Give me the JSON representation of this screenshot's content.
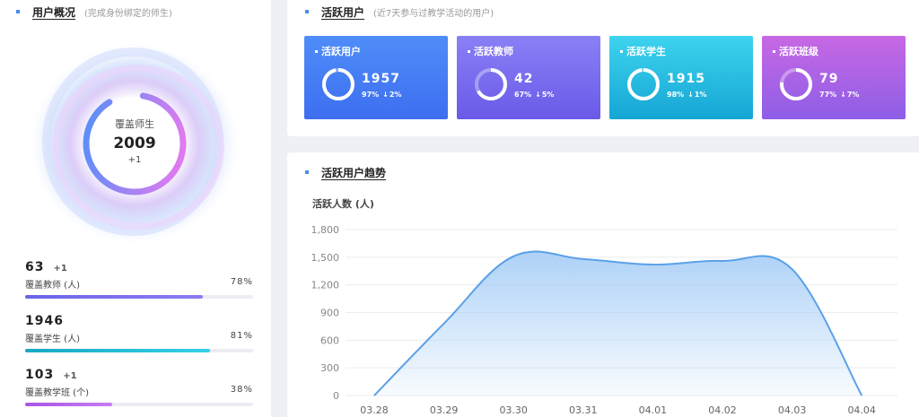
{
  "overview": {
    "title": "用户概况",
    "subtitle": "(完成身份绑定的师生)",
    "ring": {
      "label": "覆盖师生",
      "value": "2009",
      "delta": "+1"
    },
    "stats": [
      {
        "value": "63",
        "delta": "+1",
        "label": "覆盖教师 (人)",
        "pct": "78%",
        "fraction": 0.78,
        "color_from": "#6b63e8",
        "color_to": "#8b7cf4"
      },
      {
        "value": "1946",
        "delta": "",
        "label": "覆盖学生 (人)",
        "pct": "81%",
        "fraction": 0.81,
        "color_from": "#17a8c4",
        "color_to": "#35d0ea"
      },
      {
        "value": "103",
        "delta": "+1",
        "label": "覆盖教学班 (个)",
        "pct": "38%",
        "fraction": 0.38,
        "color_from": "#a855e8",
        "color_to": "#c77df2"
      }
    ]
  },
  "active": {
    "title": "活跃用户",
    "subtitle": "(近7天参与过教学活动的用户)",
    "cards": [
      {
        "title": "活跃用户",
        "value": "1957",
        "pct": "97%",
        "change": "2%",
        "fraction": 0.97,
        "color_from": "#4f8df8",
        "color_to": "#3d6ef0"
      },
      {
        "title": "活跃教师",
        "value": "42",
        "pct": "67%",
        "change": "5%",
        "fraction": 0.67,
        "color_from": "#8a80f5",
        "color_to": "#6a5ae8"
      },
      {
        "title": "活跃学生",
        "value": "1915",
        "pct": "98%",
        "change": "1%",
        "fraction": 0.98,
        "color_from": "#3ed3ee",
        "color_to": "#15a6d4"
      },
      {
        "title": "活跃班级",
        "value": "79",
        "pct": "77%",
        "change": "7%",
        "fraction": 0.77,
        "color_from": "#c868e4",
        "color_to": "#8d5ee6"
      }
    ]
  },
  "trend": {
    "title": "活跃用户趋势",
    "ylabel": "活跃人数 (人)"
  },
  "chart_data": {
    "type": "area",
    "title": "活跃用户趋势",
    "ylabel": "活跃人数 (人)",
    "xlabel": "",
    "categories": [
      "03.28",
      "03.29",
      "03.30",
      "03.31",
      "04.01",
      "04.02",
      "04.03",
      "04.04"
    ],
    "values": [
      0,
      780,
      1510,
      1480,
      1420,
      1460,
      1370,
      0
    ],
    "y_ticks": [
      "0",
      "300",
      "600",
      "900",
      "1,200",
      "1,500",
      "1,800"
    ],
    "ylim": [
      0,
      1800
    ],
    "grid": true,
    "line_color": "#5aa0e8",
    "fill_color": "#a9cff7"
  }
}
